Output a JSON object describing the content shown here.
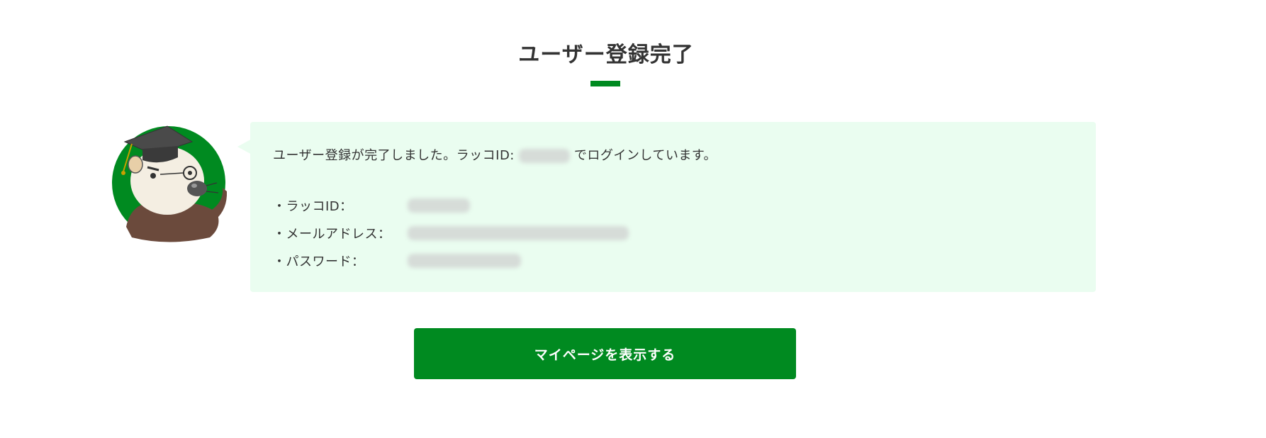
{
  "header": {
    "title": "ユーザー登録完了"
  },
  "message": {
    "before": "ユーザー登録が完了しました。ラッコID:",
    "after": "でログインしています。"
  },
  "account_info": [
    {
      "label": "・ラッコID："
    },
    {
      "label": "・メールアドレス："
    },
    {
      "label": "・パスワード："
    }
  ],
  "actions": {
    "mypage_label": "マイページを表示する"
  },
  "colors": {
    "accent": "#008a20",
    "bubble_bg": "#eafdf0",
    "text": "#333333"
  },
  "icons": {
    "mascot": "sea-otter-with-graduation-cap-icon"
  }
}
